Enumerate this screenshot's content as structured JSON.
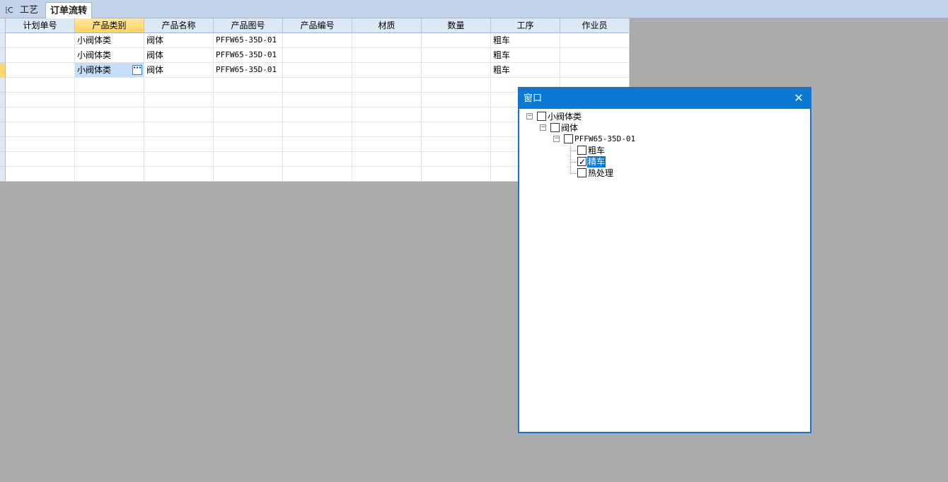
{
  "tabs": [
    {
      "label": "表C"
    },
    {
      "label": "工艺"
    },
    {
      "label": "订单流转"
    }
  ],
  "grid": {
    "columns": [
      "计划单号",
      "产品类别",
      "产品名称",
      "产品图号",
      "产品编号",
      "材质",
      "数量",
      "工序",
      "作业员"
    ],
    "rows": [
      [
        "",
        "小阀体类",
        "阀体",
        "PFFW65-35D-01",
        "",
        "",
        "",
        "粗车",
        ""
      ],
      [
        "",
        "小阀体类",
        "阀体",
        "PFFW65-35D-01",
        "",
        "",
        "",
        "粗车",
        ""
      ],
      [
        "",
        "小阀体类",
        "阀体",
        "PFFW65-35D-01",
        "",
        "",
        "",
        "粗车",
        ""
      ]
    ],
    "ellipsis": "···"
  },
  "popup": {
    "title": "窗口",
    "close": "✕",
    "tree": [
      {
        "label": "小阀体类",
        "level": 0,
        "checked": false,
        "expanded": true
      },
      {
        "label": "阀体",
        "level": 1,
        "checked": false,
        "expanded": true
      },
      {
        "label": "PFFW65-35D-01",
        "level": 2,
        "checked": false,
        "expanded": true
      },
      {
        "label": "粗车",
        "level": 3,
        "checked": false
      },
      {
        "label": "精车",
        "level": 3,
        "checked": true,
        "selected": true
      },
      {
        "label": "热处理",
        "level": 3,
        "checked": false
      }
    ]
  },
  "colors": {
    "accent": "#0b78d4",
    "header": "#dde8f5",
    "selected_header": "#ffd35c"
  }
}
